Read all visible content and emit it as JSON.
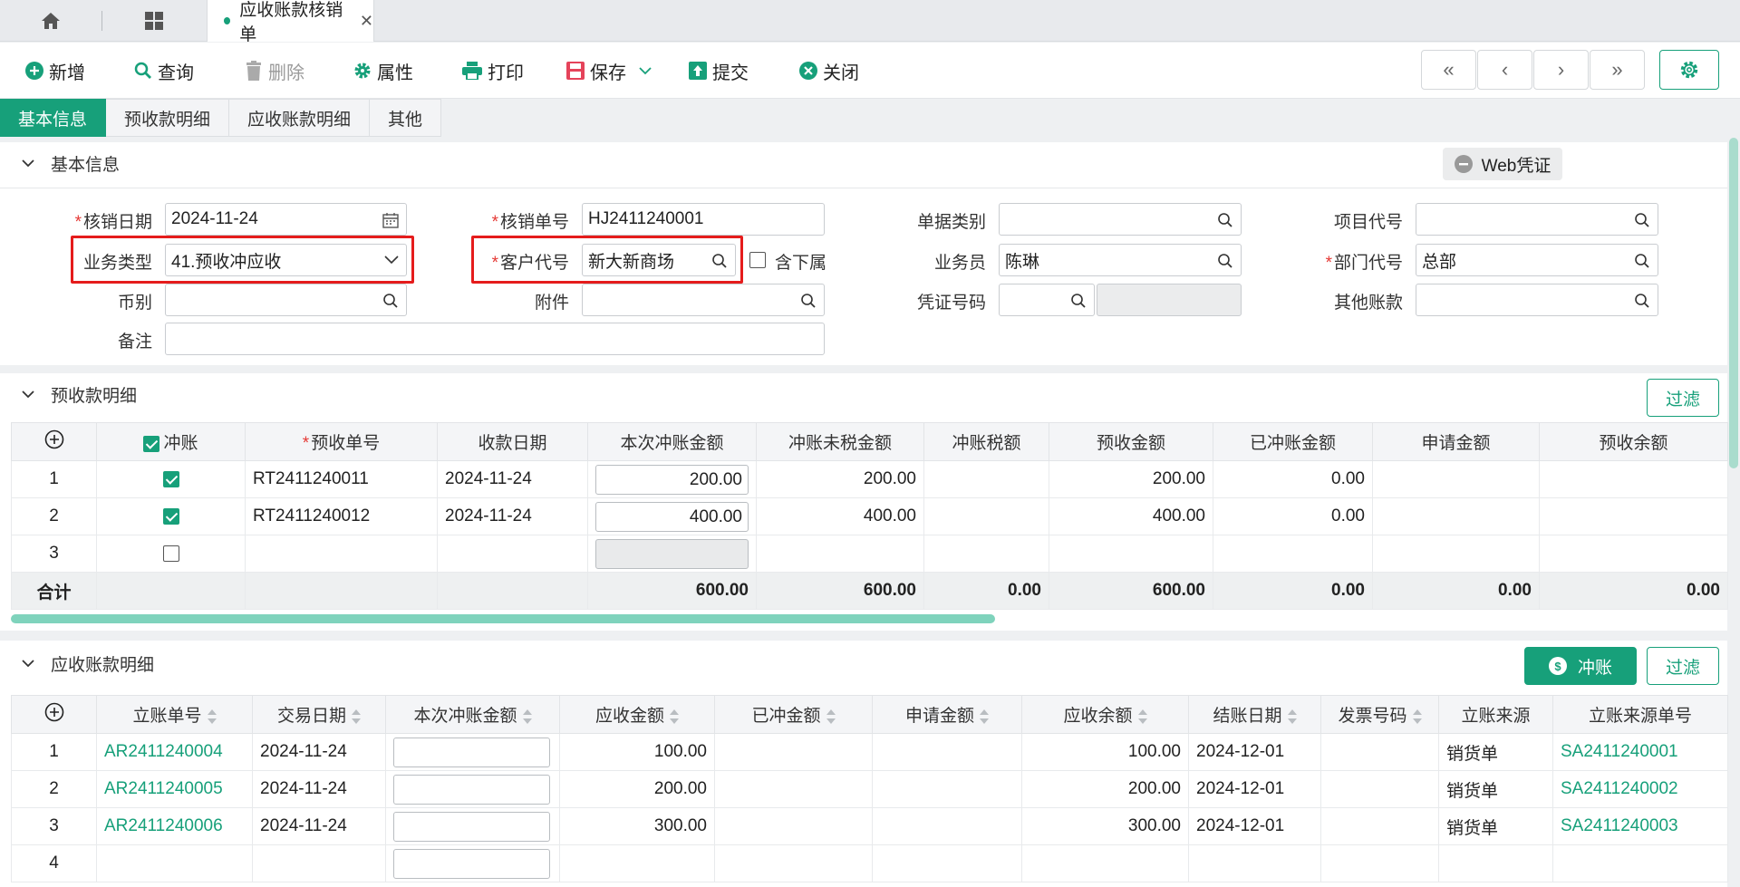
{
  "tabs": {
    "active_title": "应收账款核销单"
  },
  "toolbar": {
    "add": "新增",
    "query": "查询",
    "delete": "删除",
    "properties": "属性",
    "print": "打印",
    "save": "保存",
    "submit": "提交",
    "close": "关闭"
  },
  "section_tabs": [
    "基本信息",
    "预收款明细",
    "应收账款明细",
    "其他"
  ],
  "basic": {
    "title": "基本信息",
    "web_voucher": "Web凭证",
    "fields": {
      "write_off_date_label": "核销日期",
      "write_off_date": "2024-11-24",
      "write_off_no_label": "核销单号",
      "write_off_no": "HJ2411240001",
      "doc_type_label": "单据类别",
      "doc_type": "",
      "project_code_label": "项目代号",
      "project_code": "",
      "biz_type_label": "业务类型",
      "biz_type": "41.预收冲应收",
      "customer_code_label": "客户代号",
      "customer_code": "新大新商场",
      "include_sub_label": "含下属",
      "salesperson_label": "业务员",
      "salesperson": "陈琳",
      "dept_code_label": "部门代号",
      "dept_code": "总部",
      "currency_label": "币别",
      "currency": "",
      "attachment_label": "附件",
      "attachment": "",
      "voucher_no_label": "凭证号码",
      "voucher_no": "",
      "other_account_label": "其他账款",
      "other_account": "",
      "remark_label": "备注",
      "remark": ""
    }
  },
  "prepay": {
    "title": "预收款明细",
    "filter": "过滤",
    "headers": [
      "冲账",
      "预收单号",
      "收款日期",
      "本次冲账金额",
      "冲账未税金额",
      "冲账税额",
      "预收金额",
      "已冲账金额",
      "申请金额",
      "预收余额"
    ],
    "rows": [
      {
        "no": "1",
        "checked": true,
        "doc": "RT2411240011",
        "date": "2024-11-24",
        "amount": "200.00",
        "untaxed": "200.00",
        "tax": "",
        "prepaid": "200.00",
        "offset": "0.00",
        "applied": "",
        "balance": ""
      },
      {
        "no": "2",
        "checked": true,
        "doc": "RT2411240012",
        "date": "2024-11-24",
        "amount": "400.00",
        "untaxed": "400.00",
        "tax": "",
        "prepaid": "400.00",
        "offset": "0.00",
        "applied": "",
        "balance": ""
      },
      {
        "no": "3",
        "checked": false,
        "doc": "",
        "date": "",
        "amount": "",
        "untaxed": "",
        "tax": "",
        "prepaid": "",
        "offset": "",
        "applied": "",
        "balance": ""
      }
    ],
    "total": {
      "label": "合计",
      "amount": "600.00",
      "untaxed": "600.00",
      "tax": "0.00",
      "prepaid": "600.00",
      "offset": "0.00",
      "applied": "0.00",
      "balance": "0.00"
    }
  },
  "receivable": {
    "title": "应收账款明细",
    "offset_btn": "冲账",
    "filter": "过滤",
    "headers": [
      "立账单号",
      "交易日期",
      "本次冲账金额",
      "应收金额",
      "已冲金额",
      "申请金额",
      "应收余额",
      "结账日期",
      "发票号码",
      "立账来源",
      "立账来源单号"
    ],
    "rows": [
      {
        "no": "1",
        "doc": "AR2411240004",
        "date": "2024-11-24",
        "amount": "",
        "receivable": "100.00",
        "offset": "",
        "applied": "",
        "balance": "100.00",
        "close_date": "2024-12-01",
        "invoice": "",
        "source": "销货单",
        "source_no": "SA2411240001"
      },
      {
        "no": "2",
        "doc": "AR2411240005",
        "date": "2024-11-24",
        "amount": "",
        "receivable": "200.00",
        "offset": "",
        "applied": "",
        "balance": "200.00",
        "close_date": "2024-12-01",
        "invoice": "",
        "source": "销货单",
        "source_no": "SA2411240002"
      },
      {
        "no": "3",
        "doc": "AR2411240006",
        "date": "2024-11-24",
        "amount": "",
        "receivable": "300.00",
        "offset": "",
        "applied": "",
        "balance": "300.00",
        "close_date": "2024-12-01",
        "invoice": "",
        "source": "销货单",
        "source_no": "SA2411240003"
      },
      {
        "no": "4",
        "doc": "",
        "date": "",
        "amount": "",
        "receivable": "",
        "offset": "",
        "applied": "",
        "balance": "",
        "close_date": "",
        "invoice": "",
        "source": "",
        "source_no": ""
      }
    ]
  },
  "colors": {
    "accent": "#17a07a",
    "highlight": "#e51c1c"
  }
}
